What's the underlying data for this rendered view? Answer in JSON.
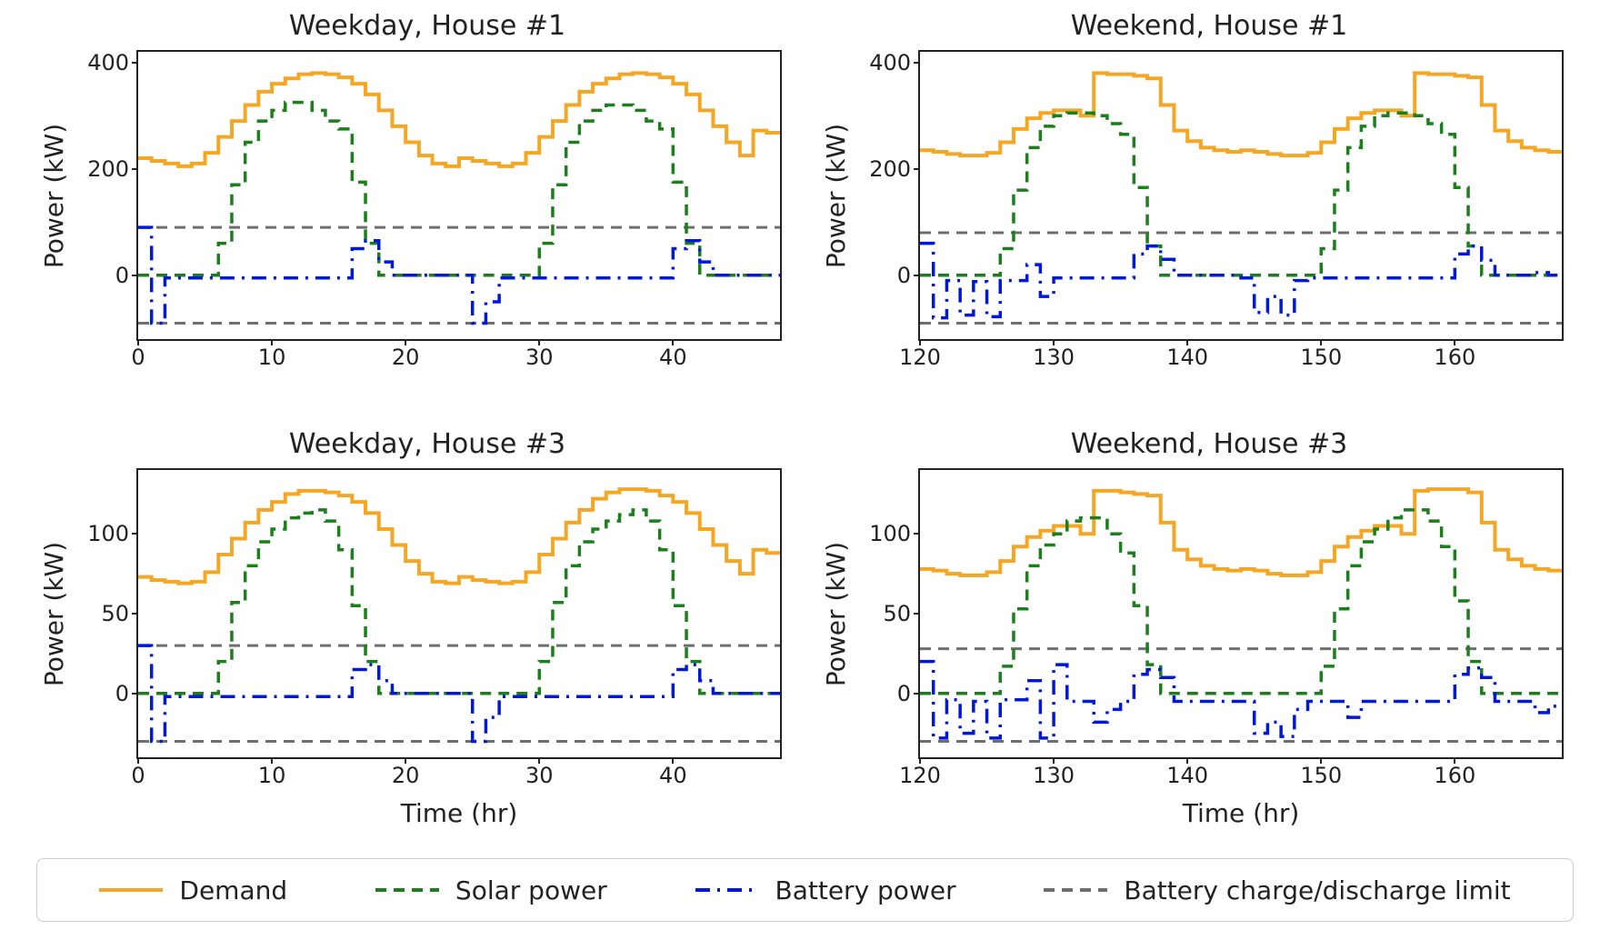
{
  "colors": {
    "demand": "#f5a623",
    "solar": "#1b7f1b",
    "battery": "#0018d8",
    "limit": "#6e6e6e"
  },
  "legend": [
    {
      "key": "demand",
      "label": "Demand",
      "style": "solid"
    },
    {
      "key": "solar",
      "label": "Solar power",
      "style": "dash"
    },
    {
      "key": "battery",
      "label": "Battery power",
      "style": "dashdot"
    },
    {
      "key": "limit",
      "label": "Battery charge/discharge limit",
      "style": "dash"
    }
  ],
  "xlabel": "Time (hr)",
  "ylabel": "Power (kW)",
  "chart_data": [
    {
      "id": "weekday-house1",
      "title": "Weekday, House #1",
      "xlim": [
        0,
        48
      ],
      "ylim": [
        -120,
        420
      ],
      "xticks": [
        0,
        10,
        20,
        30,
        40
      ],
      "yticks": [
        0,
        200,
        400
      ],
      "xlabel": "Time (hr)",
      "ylabel": "Power (kW)",
      "show_xlabel": false,
      "limit_pos": 90,
      "limit_neg": -90,
      "series": {
        "demand": [
          220,
          215,
          210,
          205,
          210,
          230,
          260,
          290,
          320,
          345,
          360,
          370,
          378,
          380,
          378,
          372,
          360,
          340,
          310,
          280,
          250,
          225,
          210,
          205,
          220,
          215,
          210,
          205,
          210,
          230,
          260,
          290,
          320,
          345,
          360,
          370,
          378,
          380,
          378,
          372,
          360,
          340,
          310,
          280,
          250,
          225,
          272,
          268
        ],
        "solar": [
          0,
          0,
          0,
          0,
          0,
          0,
          60,
          170,
          250,
          290,
          310,
          325,
          325,
          310,
          290,
          275,
          175,
          60,
          0,
          0,
          0,
          0,
          0,
          0,
          0,
          0,
          0,
          0,
          0,
          0,
          60,
          170,
          250,
          290,
          310,
          320,
          320,
          310,
          290,
          275,
          175,
          60,
          0,
          0,
          0,
          0,
          0,
          0
        ],
        "battery": [
          90,
          -90,
          -5,
          -5,
          -5,
          -5,
          -5,
          -5,
          -5,
          -5,
          -5,
          -5,
          -5,
          -5,
          -5,
          -5,
          50,
          65,
          25,
          0,
          0,
          0,
          0,
          0,
          0,
          -90,
          -50,
          -5,
          -5,
          -5,
          -5,
          -5,
          -5,
          -5,
          -5,
          -5,
          -5,
          -5,
          -5,
          -5,
          50,
          65,
          25,
          0,
          0,
          0,
          0,
          0
        ]
      }
    },
    {
      "id": "weekend-house1",
      "title": "Weekend, House #1",
      "xlim": [
        120,
        168
      ],
      "ylim": [
        -120,
        420
      ],
      "xticks": [
        120,
        130,
        140,
        150,
        160
      ],
      "yticks": [
        0,
        200,
        400
      ],
      "xlabel": "Time (hr)",
      "ylabel": "Power (kW)",
      "show_xlabel": false,
      "limit_pos": 80,
      "limit_neg": -90,
      "series": {
        "demand": [
          235,
          232,
          228,
          225,
          225,
          230,
          250,
          275,
          295,
          305,
          310,
          310,
          300,
          380,
          378,
          378,
          375,
          370,
          320,
          272,
          252,
          240,
          235,
          232,
          235,
          232,
          228,
          225,
          225,
          230,
          250,
          275,
          295,
          305,
          310,
          310,
          300,
          380,
          378,
          378,
          375,
          372,
          320,
          272,
          252,
          240,
          235,
          232
        ],
        "solar": [
          0,
          0,
          0,
          0,
          0,
          0,
          50,
          160,
          240,
          280,
          300,
          305,
          305,
          300,
          285,
          265,
          165,
          55,
          0,
          0,
          0,
          0,
          0,
          0,
          0,
          0,
          0,
          0,
          0,
          0,
          50,
          160,
          240,
          280,
          300,
          305,
          305,
          300,
          285,
          265,
          165,
          55,
          0,
          0,
          0,
          0,
          0,
          0
        ],
        "battery": [
          60,
          -80,
          -10,
          -75,
          -12,
          -78,
          -10,
          -10,
          20,
          -40,
          -5,
          -5,
          -5,
          -5,
          -5,
          -5,
          40,
          55,
          30,
          0,
          0,
          0,
          0,
          0,
          -5,
          -70,
          -40,
          -75,
          -10,
          -5,
          -5,
          -5,
          -5,
          -5,
          -5,
          -5,
          -5,
          -5,
          -5,
          -5,
          40,
          55,
          28,
          0,
          0,
          0,
          5,
          0
        ]
      }
    },
    {
      "id": "weekday-house3",
      "title": "Weekday, House #3",
      "xlim": [
        0,
        48
      ],
      "ylim": [
        -40,
        140
      ],
      "xticks": [
        0,
        10,
        20,
        30,
        40
      ],
      "yticks": [
        0,
        50,
        100
      ],
      "xlabel": "Time (hr)",
      "ylabel": "Power (kW)",
      "show_xlabel": true,
      "limit_pos": 30,
      "limit_neg": -30,
      "series": {
        "demand": [
          73,
          71,
          70,
          69,
          70,
          76,
          87,
          97,
          107,
          115,
          120,
          125,
          127,
          127,
          126,
          124,
          120,
          113,
          103,
          93,
          83,
          75,
          70,
          69,
          73,
          71,
          70,
          69,
          70,
          76,
          87,
          97,
          107,
          115,
          122,
          126,
          128,
          128,
          127,
          124,
          120,
          113,
          103,
          93,
          83,
          75,
          90,
          88
        ],
        "solar": [
          0,
          0,
          0,
          0,
          0,
          0,
          20,
          57,
          80,
          95,
          103,
          110,
          113,
          115,
          108,
          90,
          55,
          20,
          0,
          0,
          0,
          0,
          0,
          0,
          0,
          0,
          0,
          0,
          0,
          0,
          20,
          57,
          80,
          95,
          103,
          108,
          112,
          115,
          108,
          90,
          55,
          20,
          0,
          0,
          0,
          0,
          0,
          0
        ],
        "battery": [
          30,
          -30,
          -2,
          -2,
          -2,
          -2,
          -2,
          -2,
          -2,
          -2,
          -2,
          -2,
          -2,
          -2,
          -2,
          -2,
          15,
          18,
          8,
          0,
          0,
          0,
          0,
          0,
          0,
          -30,
          -15,
          -2,
          -2,
          -2,
          -2,
          -2,
          -2,
          -2,
          -2,
          -2,
          -2,
          -2,
          -2,
          -2,
          15,
          18,
          8,
          0,
          0,
          0,
          0,
          0
        ]
      }
    },
    {
      "id": "weekend-house3",
      "title": "Weekend, House #3",
      "xlim": [
        120,
        168
      ],
      "ylim": [
        -40,
        140
      ],
      "xticks": [
        120,
        130,
        140,
        150,
        160
      ],
      "yticks": [
        0,
        50,
        100
      ],
      "xlabel": "Time (hr)",
      "ylabel": "Power (kW)",
      "show_xlabel": true,
      "limit_pos": 28,
      "limit_neg": -30,
      "series": {
        "demand": [
          78,
          77,
          75,
          74,
          74,
          76,
          83,
          92,
          98,
          102,
          105,
          105,
          100,
          127,
          127,
          126,
          125,
          124,
          107,
          90,
          84,
          80,
          78,
          77,
          78,
          77,
          75,
          74,
          74,
          76,
          83,
          92,
          98,
          102,
          105,
          105,
          100,
          127,
          128,
          128,
          128,
          126,
          107,
          90,
          84,
          80,
          78,
          77
        ],
        "solar": [
          0,
          0,
          0,
          0,
          0,
          0,
          17,
          53,
          80,
          93,
          100,
          108,
          110,
          110,
          100,
          88,
          55,
          18,
          0,
          0,
          0,
          0,
          0,
          0,
          0,
          0,
          0,
          0,
          0,
          0,
          17,
          53,
          80,
          95,
          103,
          110,
          115,
          115,
          108,
          92,
          58,
          20,
          0,
          0,
          0,
          0,
          0,
          0
        ],
        "battery": [
          20,
          -28,
          -4,
          -25,
          -5,
          -28,
          -4,
          -4,
          8,
          -28,
          18,
          -5,
          -5,
          -18,
          -10,
          -5,
          12,
          15,
          10,
          -5,
          -5,
          -5,
          -5,
          -5,
          -5,
          -25,
          -18,
          -27,
          -10,
          -5,
          -5,
          -5,
          -15,
          -5,
          -5,
          -5,
          -5,
          -5,
          -5,
          -5,
          12,
          16,
          10,
          -5,
          -5,
          -5,
          -12,
          -8
        ]
      }
    }
  ]
}
